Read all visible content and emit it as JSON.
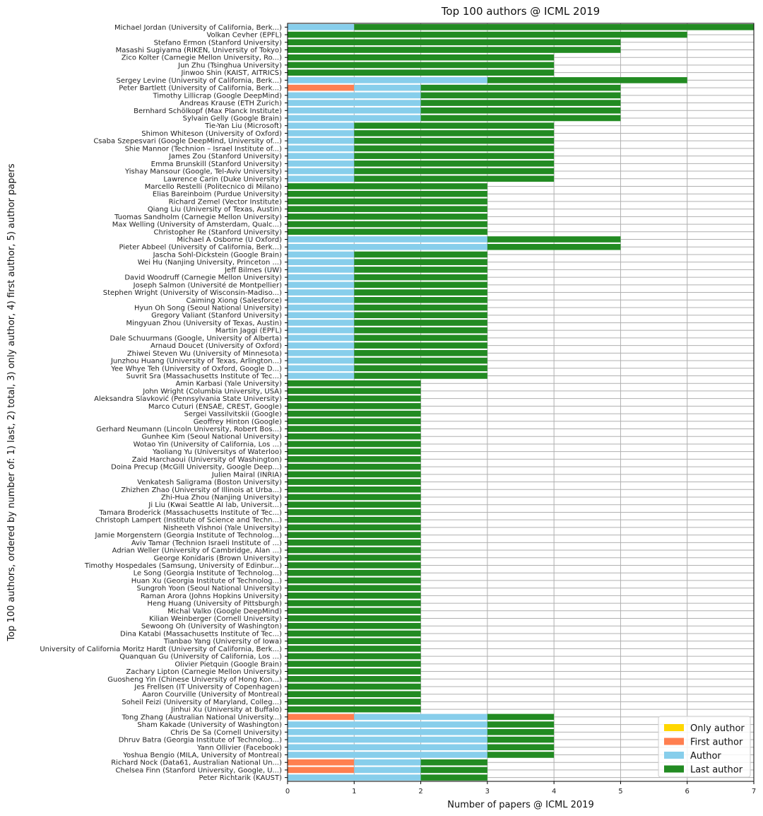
{
  "chart_data": {
    "type": "bar",
    "orientation": "horizontal",
    "stacked": true,
    "title": "Top 100 authors @ ICML 2019",
    "xlabel": "Number of papers @ ICML 2019",
    "ylabel": "Top 100 authors, ordered by number of: 1) last, 2) total, 3) only author, 4) first author, 5) author papers",
    "xlim": [
      0,
      7
    ],
    "xticks": [
      "0",
      "1",
      "2",
      "3",
      "4",
      "5",
      "6",
      "7"
    ],
    "grid": true,
    "legend_position": "bottom-right",
    "series": [
      {
        "name": "Only author",
        "color": "#FFD700"
      },
      {
        "name": "First author",
        "color": "#FF7F50"
      },
      {
        "name": "Author",
        "color": "#87CEEB"
      },
      {
        "name": "Last author",
        "color": "#228B22"
      }
    ],
    "categories": [
      "Michael Jordan (University of California, Berk...)",
      "Volkan Cevher (EPFL)",
      "Stefano Ermon (Stanford University)",
      "Masashi Sugiyama (RIKEN, University of Tokyo)",
      "Zico Kolter (Carnegie Mellon University, Ro...)",
      "Jun Zhu (Tsinghua University)",
      "Jinwoo Shin (KAIST, AITRICS)",
      "Sergey Levine (University of California, Berk...)",
      "Peter Bartlett (University of California, Berk...)",
      "Timothy Lillicrap (Google DeepMind)",
      "Andreas Krause (ETH Zurich)",
      "Bernhard Schölkopf (Max Planck Institute)",
      "Sylvain Gelly (Google Brain)",
      "Tie-Yan Liu (Microsoft)",
      "Shimon Whiteson (University of Oxford)",
      "Csaba Szepesvari (Google DeepMind, University of...)",
      "Shie Mannor (Technion – Israel Institute of...)",
      "James Zou (Stanford University)",
      "Emma Brunskill (Stanford University)",
      "Yishay Mansour (Google, Tel-Aviv University)",
      "Lawrence Carin (Duke University)",
      "Marcello Restelli (Politecnico di Milano)",
      "Elias Bareinboim (Purdue University)",
      "Richard Zemel (Vector Institute)",
      "Qiang Liu (University of Texas, Austin)",
      "Tuomas Sandholm (Carnegie Mellon University)",
      "Max Welling (University of Amsterdam, Qualc...)",
      "Christopher Re (Stanford University)",
      "Michael A Osborne (U Oxford)",
      "Pieter Abbeel (University of California, Berk...)",
      "Jascha Sohl-Dickstein (Google Brain)",
      "Wei Hu (Nanjing University, Princeton ...)",
      "Jeff Bilmes (UW)",
      "David Woodruff (Carnegie Mellon University)",
      "Joseph Salmon (Université de Montpellier)",
      "Stephen Wright (University of Wisconsin-Madiso...)",
      "Caiming Xiong (Salesforce)",
      "Hyun Oh Song (Seoul National University)",
      "Gregory Valiant (Stanford University)",
      "Mingyuan Zhou (University of Texas, Austin)",
      "Martin Jaggi (EPFL)",
      "Dale Schuurmans (Google, University of Alberta)",
      "Arnaud Doucet (University of Oxford)",
      "Zhiwei Steven Wu (University of Minnesota)",
      "Junzhou Huang (University of Texas, Arlington...)",
      "Yee Whye Teh (University of Oxford, Google D...)",
      "Suvrit Sra (Massachusetts Institute of Tec...)",
      "Amin Karbasi (Yale University)",
      "John Wright (Columbia University, USA)",
      "Aleksandra Slavković (Pennsylvania State University)",
      "Marco Cuturi (ENSAE, CREST, Google)",
      "Sergei Vassilvitskii (Google)",
      "Geoffrey Hinton (Google)",
      "Gerhard Neumann (Lincoln University, Robert Bos...)",
      "Gunhee Kim (Seoul National University)",
      "Wotao Yin (University of California, Los ...)",
      "Yaoliang Yu (Universitys of Waterloo)",
      "Zaid Harchaoui (University of Washington)",
      "Doina Precup (McGill University, Google Deep...)",
      "Julien Mairal (INRIA)",
      "Venkatesh Saligrama (Boston University)",
      "Zhizhen Zhao (University of Illinois at Urba...)",
      "Zhi-Hua Zhou (Nanjing University)",
      "Ji Liu (Kwai Seattle AI lab, Universit...)",
      "Tamara Broderick (Massachusetts Institute of Tec...)",
      "Christoph Lampert (Institute of Science and Techn...)",
      "Nisheeth Vishnoi (Yale University)",
      "Jamie Morgenstern (Georgia Institute of Technolog...)",
      "Aviv Tamar (Technion Israeli Institute of ...)",
      "Adrian Weller (University of Cambridge, Alan ...)",
      "George Konidaris (Brown University)",
      "Timothy Hospedales (Samsung, University of Edinbur...)",
      "Le Song (Georgia Institute of Technolog...)",
      "Huan Xu (Georgia Institute of Technolog...)",
      "Sungroh Yoon (Seoul National University)",
      "Raman Arora (Johns Hopkins University)",
      "Heng Huang (University of Pittsburgh)",
      "Michal Valko (Google DeepMind)",
      "Kilian Weinberger (Cornell University)",
      "Sewoong Oh (University of Washington)",
      "Dina Katabi (Massachusetts Institute of Tec...)",
      "Tianbao Yang (University of Iowa)",
      "University of California Moritz Hardt (University of California, Berk...)",
      "Quanquan Gu (University of California, Los ...)",
      "Olivier Pietquin (Google Brain)",
      "Zachary Lipton (Carnegie Mellon University)",
      "Guosheng Yin (Chinese University of Hong Kon...)",
      "Jes Frellsen (IT University of Copenhagen)",
      "Aaron Courville (University of Montreal)",
      "Soheil Feizi (University of Maryland, Colleg...)",
      "Jinhui Xu (University at Buffalo)",
      "Tong Zhang (Australian National University...)",
      "Sham Kakade (University of Washington)",
      "Chris De Sa (Cornell University)",
      "Dhruv Batra (Georgia Institute of Technolog...)",
      "Yann Ollivier (Facebook)",
      "Yoshua Bengio (MILA, University of Montreal)",
      "Richard Nock (Data61, Australian National Un...)",
      "Chelsea Finn (Stanford University, Google, U...)",
      "Peter Richtarik (KAUST)"
    ],
    "values": {
      "only_author": [
        0,
        0,
        0,
        0,
        0,
        0,
        0,
        0,
        0,
        0,
        0,
        0,
        0,
        0,
        0,
        0,
        0,
        0,
        0,
        0,
        0,
        0,
        0,
        0,
        0,
        0,
        0,
        0,
        0,
        0,
        0,
        0,
        0,
        0,
        0,
        0,
        0,
        0,
        0,
        0,
        0,
        0,
        0,
        0,
        0,
        0,
        0,
        0,
        0,
        0,
        0,
        0,
        0,
        0,
        0,
        0,
        0,
        0,
        0,
        0,
        0,
        0,
        0,
        0,
        0,
        0,
        0,
        0,
        0,
        0,
        0,
        0,
        0,
        0,
        0,
        0,
        0,
        0,
        0,
        0,
        0,
        0,
        0,
        0,
        0,
        0,
        0,
        0,
        0,
        0,
        0,
        0,
        0,
        0,
        0,
        0,
        0,
        0,
        0,
        0
      ],
      "first_author": [
        0,
        0,
        0,
        0,
        0,
        0,
        0,
        0,
        1,
        0,
        0,
        0,
        0,
        0,
        0,
        0,
        0,
        0,
        0,
        0,
        0,
        0,
        0,
        0,
        0,
        0,
        0,
        0,
        0,
        0,
        0,
        0,
        0,
        0,
        0,
        0,
        0,
        0,
        0,
        0,
        0,
        0,
        0,
        0,
        0,
        0,
        0,
        0,
        0,
        0,
        0,
        0,
        0,
        0,
        0,
        0,
        0,
        0,
        0,
        0,
        0,
        0,
        0,
        0,
        0,
        0,
        0,
        0,
        0,
        0,
        0,
        0,
        0,
        0,
        0,
        0,
        0,
        0,
        0,
        0,
        0,
        0,
        0,
        0,
        0,
        0,
        0,
        0,
        0,
        0,
        0,
        1,
        0,
        0,
        0,
        0,
        0,
        1,
        1,
        0
      ],
      "author": [
        1,
        0,
        0,
        0,
        0,
        0,
        0,
        3,
        1,
        2,
        2,
        2,
        2,
        1,
        1,
        1,
        1,
        1,
        1,
        1,
        1,
        0,
        0,
        0,
        0,
        0,
        0,
        0,
        3,
        3,
        1,
        1,
        1,
        1,
        1,
        1,
        1,
        1,
        1,
        1,
        1,
        1,
        1,
        1,
        1,
        1,
        1,
        0,
        0,
        0,
        0,
        0,
        0,
        0,
        0,
        0,
        0,
        0,
        0,
        0,
        0,
        0,
        0,
        0,
        0,
        0,
        0,
        0,
        0,
        0,
        0,
        0,
        0,
        0,
        0,
        0,
        0,
        0,
        0,
        0,
        0,
        0,
        0,
        0,
        0,
        0,
        0,
        0,
        0,
        0,
        0,
        2,
        3,
        3,
        3,
        3,
        3,
        1,
        1,
        2
      ],
      "last_author": [
        6,
        6,
        5,
        5,
        4,
        4,
        4,
        3,
        3,
        3,
        3,
        3,
        3,
        3,
        3,
        3,
        3,
        3,
        3,
        3,
        3,
        3,
        3,
        3,
        3,
        3,
        3,
        3,
        2,
        2,
        2,
        2,
        2,
        2,
        2,
        2,
        2,
        2,
        2,
        2,
        2,
        2,
        2,
        2,
        2,
        2,
        2,
        2,
        2,
        2,
        2,
        2,
        2,
        2,
        2,
        2,
        2,
        2,
        2,
        2,
        2,
        2,
        2,
        2,
        2,
        2,
        2,
        2,
        2,
        2,
        2,
        2,
        2,
        2,
        2,
        2,
        2,
        2,
        2,
        2,
        2,
        2,
        2,
        2,
        2,
        2,
        2,
        2,
        2,
        2,
        2,
        1,
        1,
        1,
        1,
        1,
        1,
        1,
        1,
        1
      ]
    }
  }
}
